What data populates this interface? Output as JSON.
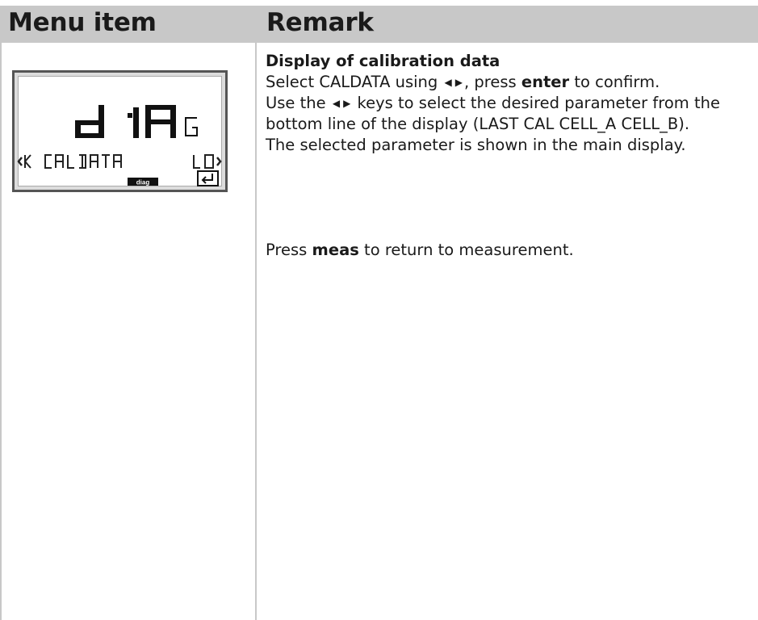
{
  "header": {
    "col1": "Menu item",
    "col2": "Remark"
  },
  "display": {
    "main_text": "dIAG",
    "bottom_left_icon": "arrow-left-K",
    "bottom_text": "CALDATA",
    "bottom_right_text": "LO",
    "mode_label": "diag",
    "enter_icon": "enter-icon"
  },
  "remark": {
    "title": "Display of calibration data",
    "line1_a": "Select CALDATA using",
    "line1_b": ", press",
    "line1_bold": "enter",
    "line1_c": "to confirm.",
    "line2_a": "Use the",
    "line2_b": "keys to select the desired parameter from the bottom line of the display (LAST CAL  CELL_A CELL_B).",
    "line3": "The selected parameter is shown in the main display.",
    "line4_a": "Press",
    "line4_bold": "meas",
    "line4_b": "to return to measurement."
  }
}
